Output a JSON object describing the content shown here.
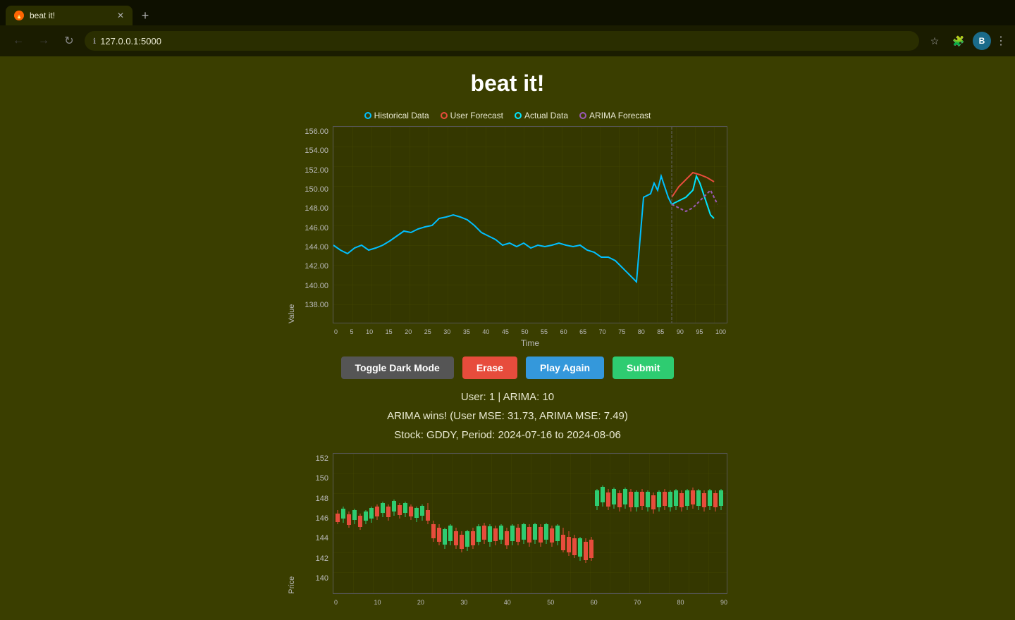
{
  "browser": {
    "tab_title": "beat it!",
    "url": "127.0.0.1:5000",
    "new_tab_icon": "+",
    "back_disabled": false,
    "forward_disabled": false,
    "profile_letter": "B"
  },
  "app": {
    "title": "beat it!",
    "legend": [
      {
        "label": "Historical Data",
        "color": "#00bfff",
        "border_color": "#00bfff"
      },
      {
        "label": "User Forecast",
        "color": "#e74c3c",
        "border_color": "#e74c3c"
      },
      {
        "label": "Actual Data",
        "color": "#00e5ff",
        "border_color": "#00e5ff"
      },
      {
        "label": "ARIMA Forecast",
        "color": "#9b59b6",
        "border_color": "#9b59b6"
      }
    ],
    "buttons": {
      "dark_mode": "Toggle Dark Mode",
      "erase": "Erase",
      "play_again": "Play Again",
      "submit": "Submit"
    },
    "stats": {
      "score_line": "User: 1 | ARIMA: 10",
      "result_line": "ARIMA wins! (User MSE: 31.73, ARIMA MSE: 7.49)",
      "stock_line": "Stock: GDDY, Period: 2024-07-16 to 2024-08-06"
    },
    "main_chart": {
      "y_axis_label": "Value",
      "x_axis_label": "Time",
      "y_ticks": [
        "156.00",
        "154.00",
        "152.00",
        "150.00",
        "148.00",
        "146.00",
        "144.00",
        "142.00",
        "140.00",
        "138.00"
      ],
      "x_ticks": [
        "0",
        "5",
        "10",
        "15",
        "20",
        "25",
        "30",
        "35",
        "40",
        "45",
        "50",
        "55",
        "60",
        "65",
        "70",
        "75",
        "80",
        "85",
        "90",
        "95",
        "100"
      ]
    },
    "candlestick_chart": {
      "y_axis_label": "Price",
      "y_ticks": [
        "152-",
        "150-",
        "148-",
        "146-",
        "144-",
        "142-",
        "140-"
      ],
      "x_ticks": [
        "0",
        "10",
        "20",
        "30",
        "40",
        "50",
        "60",
        "70",
        "80",
        "90"
      ]
    }
  }
}
